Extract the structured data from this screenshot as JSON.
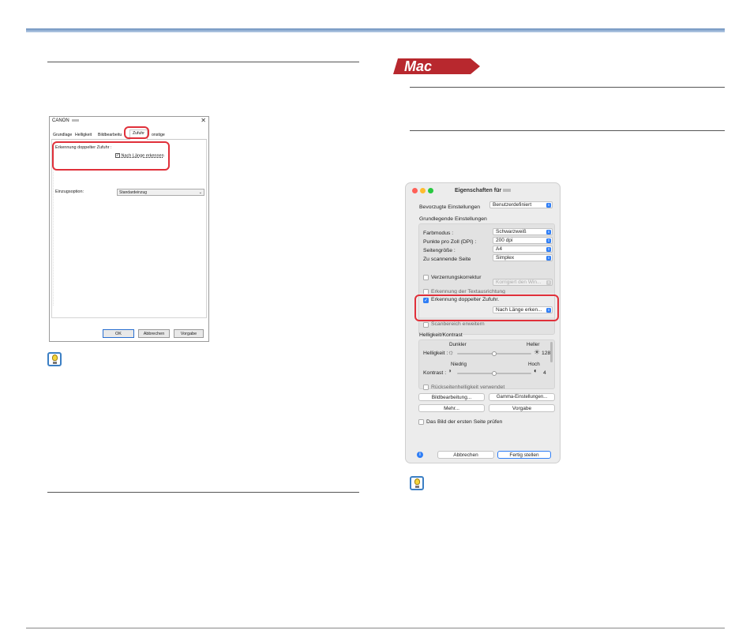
{
  "windows_dialog": {
    "title": "CANON",
    "close_glyph": "✕",
    "tabs": [
      "Grundlage",
      "Helligkeit",
      "Bildbearbeitu",
      "Zufuhr",
      "onstige"
    ],
    "double_feed_label": "Erkennung doppelter Zufuhr :",
    "length_checkbox_label": "Nach Länge erkennen",
    "feed_option_label": "Einzugsoption:",
    "feed_option_value": "Standardeinzug",
    "buttons": {
      "ok": "OK",
      "cancel": "Abbrechen",
      "default": "Vorgabe"
    }
  },
  "mac_badge": "Mac",
  "mac_dialog": {
    "title": "Eigenschaften für",
    "preferred_label": "Bevorzugte Einstellungen",
    "preferred_value": "Benutzerdefiniert",
    "basic_settings_header": "Grundlegende Einstellungen",
    "color_mode_label": "Farbmodus :",
    "color_mode_value": "Schwarzweiß",
    "dpi_label": "Punkte pro Zoll (DPI) :",
    "dpi_value": "200 dpi",
    "page_size_label": "Seitengröße :",
    "page_size_value": "A4",
    "side_label": "Zu scannende Seite",
    "side_value": "Simplex",
    "skew_label": "Verzerrungskorrektur",
    "skew_select": "Korrigiert den Win...",
    "text_orientation_label": "Erkennung der Textausrichtung",
    "double_feed_label": "Erkennung doppelter Zufuhr.",
    "double_feed_select": "Nach Länge erken...",
    "scan_area_label": "Scanbereich erweitern",
    "brightness_header": "Helligkeit/Kontrast",
    "brightness_label": "Helligkeit :",
    "brightness_low": "Dunkler",
    "brightness_high": "Heller",
    "brightness_value": "128",
    "contrast_label": "Kontrast :",
    "contrast_low": "Niedrig",
    "contrast_high": "Hoch",
    "contrast_value": "4",
    "backside_label": "Rückseitenhelligkeit verwendet",
    "btn_image_processing": "Bildbearbeitung...",
    "btn_gamma": "Gamma-Einstellungen...",
    "btn_more": "Mehr...",
    "btn_default": "Vorgabe",
    "first_page_label": "Das Bild der ersten Seite prüfen",
    "btn_cancel": "Abbrechen",
    "btn_done": "Fertig stellen",
    "info_glyph": "i",
    "brightness_slider_fraction": 0.5,
    "contrast_slider_fraction": 0.5,
    "accent_color": "#2f7ef6"
  },
  "annotation_color": "#e0303a",
  "icons": [
    "close-icon",
    "tip-lightbulb-icon",
    "sun-icon",
    "contrast-icon",
    "info-icon",
    "checkmark-icon"
  ]
}
